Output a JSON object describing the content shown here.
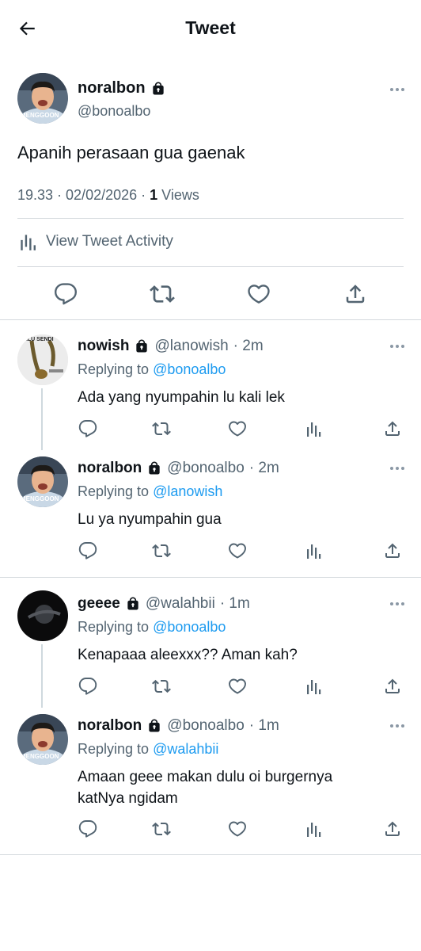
{
  "header": {
    "title": "Tweet",
    "back_icon": "arrow-left-icon"
  },
  "main_tweet": {
    "name": "noralbon",
    "handle": "@bonoalbo",
    "text": "Apanih perasaan gua gaenak",
    "time": "19.33 · 02/02/2026 · ",
    "views_count": "1",
    "views_label": " Views",
    "activity_label": "View Tweet Activity",
    "avatar_caption": "MENGGOON"
  },
  "replies": [
    {
      "name": "nowish",
      "handle": "@lanowish",
      "time": "· 2m",
      "replying_prefix": "Replying to ",
      "replying_to": "@bonoalbo",
      "text": "Ada yang nyumpahin lu kali lek",
      "avatar_caption": "MALU SENDI"
    },
    {
      "name": "noralbon",
      "handle": "@bonoalbo",
      "time": "· 2m",
      "replying_prefix": "Replying to ",
      "replying_to": "@lanowish",
      "text": "Lu ya nyumpahin gua",
      "avatar_caption": "MENGGOON"
    },
    {
      "name": "geeee",
      "handle": "@walahbii",
      "time": "· 1m",
      "replying_prefix": "Replying to ",
      "replying_to": "@bonoalbo",
      "text": "Kenapaaa aleexxx?? Aman kah?"
    },
    {
      "name": "noralbon",
      "handle": "@bonoalbo",
      "time": "· 1m",
      "replying_prefix": "Replying to ",
      "replying_to": "@walahbii",
      "text_line1": "Amaan geee makan dulu oi burgernya",
      "text_line2": "katNya ngidam",
      "avatar_caption": "MENGGOON"
    }
  ],
  "colors": {
    "accent": "#1d9bf0",
    "secondary_text": "#536471",
    "divider": "#d4d9dd"
  }
}
